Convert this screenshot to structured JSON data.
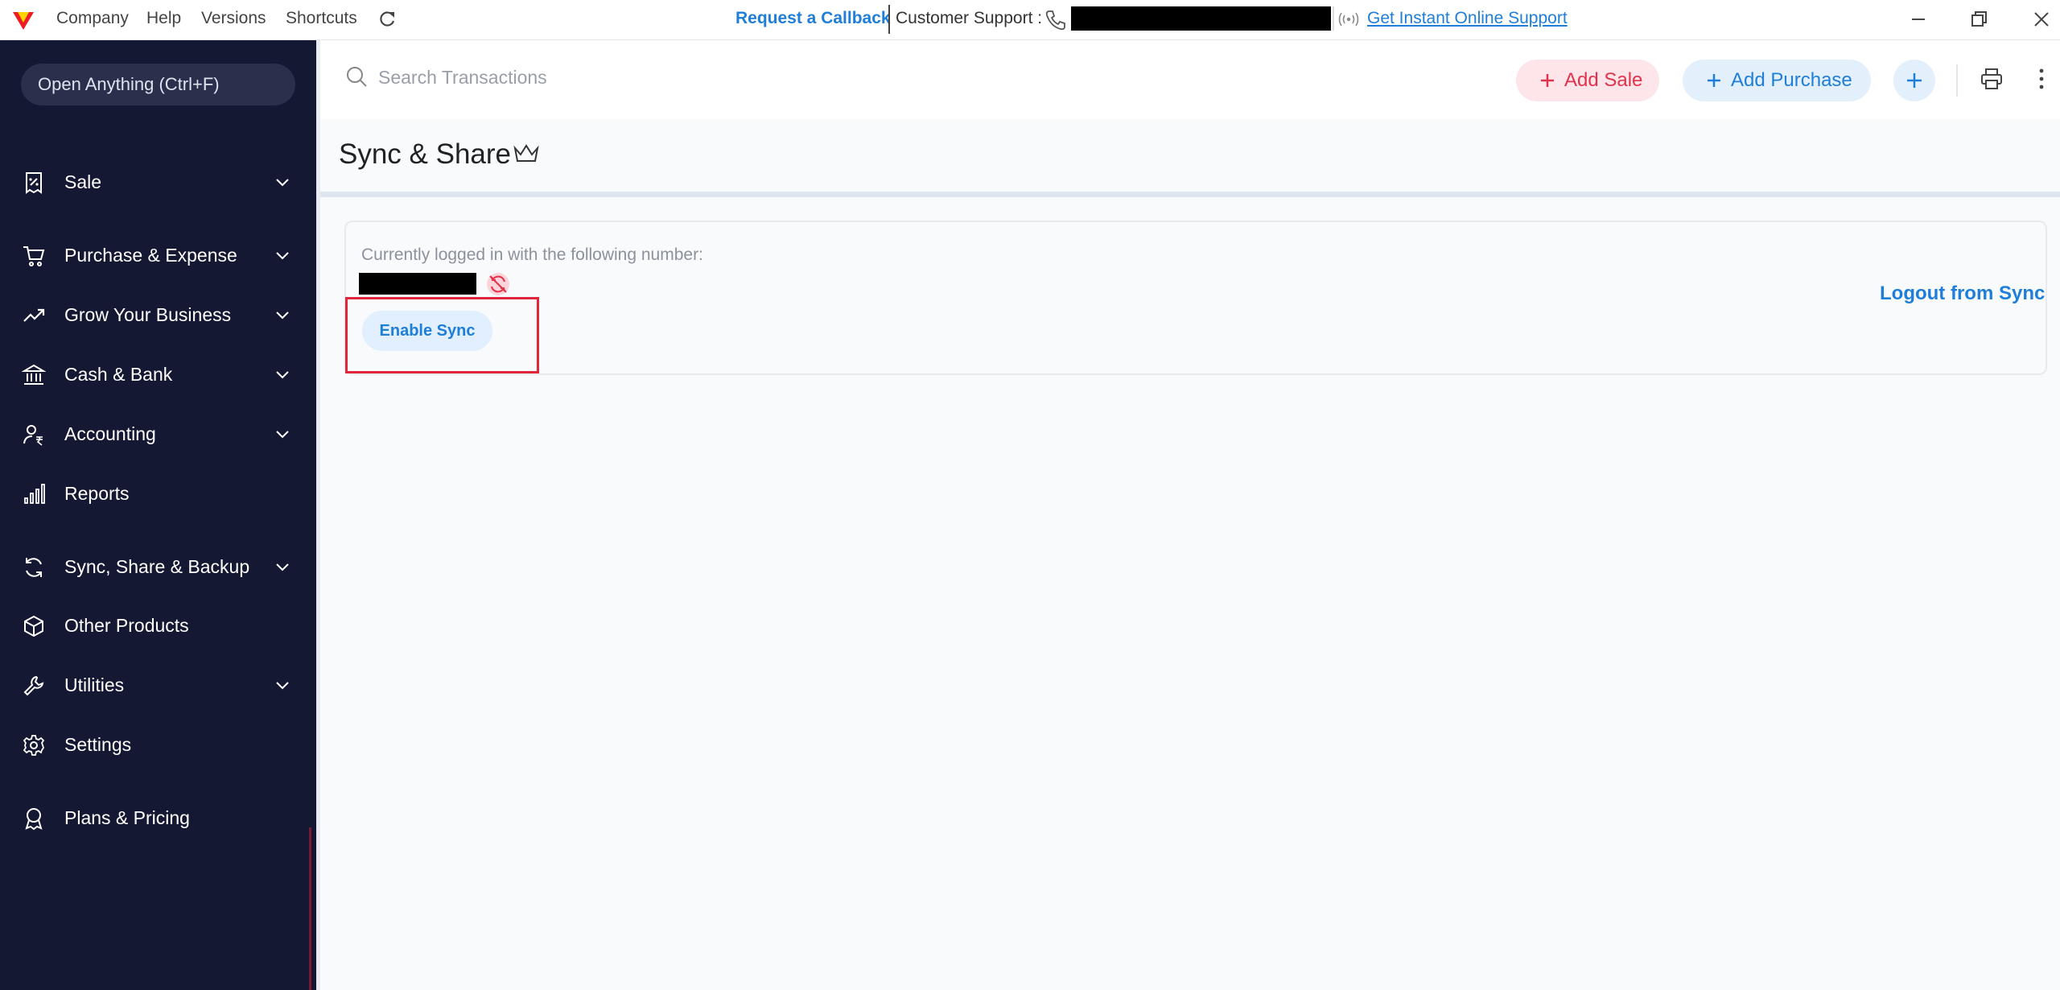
{
  "titlebar": {
    "menu": [
      "Company",
      "Help",
      "Versions",
      "Shortcuts"
    ],
    "request_callback": "Request a Callback",
    "customer_support_label": "Customer Support :",
    "online_support_link": "Get Instant Online Support"
  },
  "sidebar": {
    "open_anything": "Open Anything (Ctrl+F)",
    "items": [
      {
        "label": "Sale",
        "icon": "receipt-icon",
        "expandable": true
      },
      {
        "label": "Purchase & Expense",
        "icon": "cart-icon",
        "expandable": true
      },
      {
        "label": "Grow Your Business",
        "icon": "trend-up-icon",
        "expandable": true
      },
      {
        "label": "Cash & Bank",
        "icon": "bank-icon",
        "expandable": true
      },
      {
        "label": "Accounting",
        "icon": "accounting-user-icon",
        "expandable": true
      },
      {
        "label": "Reports",
        "icon": "bar-chart-icon",
        "expandable": false
      },
      {
        "label": "Sync, Share & Backup",
        "icon": "sync-icon",
        "expandable": true
      },
      {
        "label": "Other Products",
        "icon": "cube-icon",
        "expandable": false
      },
      {
        "label": "Utilities",
        "icon": "wrench-icon",
        "expandable": true
      },
      {
        "label": "Settings",
        "icon": "gear-icon",
        "expandable": false
      },
      {
        "label": "Plans & Pricing",
        "icon": "award-icon",
        "expandable": false
      }
    ]
  },
  "header": {
    "search_placeholder": "Search Transactions",
    "add_sale": "Add Sale",
    "add_purchase": "Add Purchase"
  },
  "page": {
    "title": "Sync & Share",
    "logged_in_label": "Currently logged in with the following number:",
    "enable_sync": "Enable Sync",
    "logout_sync": "Logout from Sync"
  },
  "colors": {
    "sidebar_bg": "#141832",
    "accent_blue": "#1e7ed8",
    "accent_red": "#e2334d",
    "highlight_red": "#e1263b"
  }
}
